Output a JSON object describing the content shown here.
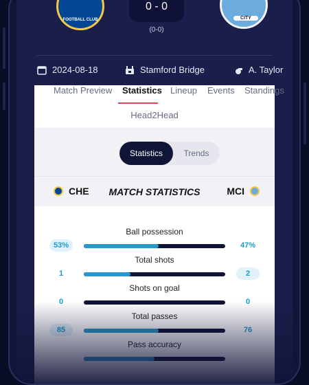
{
  "match": {
    "score": "0 - 0",
    "half_time": "(0-0)",
    "home_crest_text": "FOOTBALL CLUB",
    "away_crest_text": "CITY"
  },
  "info": {
    "date": "2024-08-18",
    "stadium": "Stamford Bridge",
    "referee": "A. Taylor"
  },
  "tabs": {
    "preview": "Match Preview",
    "statistics": "Statistics",
    "lineup": "Lineup",
    "events": "Events",
    "standings": "Standings",
    "h2h": "Head2Head"
  },
  "toggle": {
    "on": "Statistics",
    "off": "Trends"
  },
  "header": {
    "home": "CHE",
    "title": "MATCH STATISTICS",
    "away": "MCI"
  },
  "stats": [
    {
      "name": "Ball possession",
      "home": "53%",
      "away": "47%",
      "home_share": 0.53
    },
    {
      "name": "Total shots",
      "home": "1",
      "away": "2",
      "home_share": 0.33
    },
    {
      "name": "Shots on goal",
      "home": "0",
      "away": "0",
      "home_share": 0.0
    },
    {
      "name": "Total passes",
      "home": "85",
      "away": "76",
      "home_share": 0.53
    },
    {
      "name": "Pass accuracy",
      "home": "",
      "away": "",
      "home_share": 0.5
    }
  ],
  "colors": {
    "home_bar": "#2897c9",
    "away_bar": "#101436",
    "accent": "#e0445a"
  }
}
